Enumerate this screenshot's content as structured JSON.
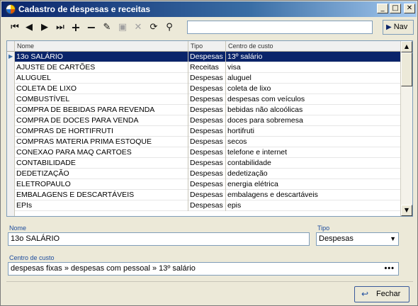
{
  "window": {
    "title": "Cadastro de despesas e receitas"
  },
  "toolbar": {
    "icons": [
      "first-record-icon",
      "prev-record-icon",
      "next-record-icon",
      "last-record-icon",
      "add-icon",
      "delete-icon",
      "edit-icon",
      "save-icon",
      "cancel-icon",
      "refresh-icon",
      "find-icon"
    ],
    "search_value": "",
    "nav_label": "Nav"
  },
  "grid": {
    "columns": [
      "Nome",
      "Tipo",
      "Centro de custo"
    ],
    "rows": [
      [
        "13o SALÁRIO",
        "Despesas",
        "13º salário"
      ],
      [
        "AJUSTE DE CARTÕES",
        "Receitas",
        "visa"
      ],
      [
        "ALUGUEL",
        "Despesas",
        "aluguel"
      ],
      [
        "COLETA DE LIXO",
        "Despesas",
        "coleta de lixo"
      ],
      [
        "COMBUSTÍVEL",
        "Despesas",
        "despesas com veículos"
      ],
      [
        "COMPRA DE BEBIDAS PARA REVENDA",
        "Despesas",
        "bebidas não alcoólicas"
      ],
      [
        "COMPRA DE DOCES PARA VENDA",
        "Despesas",
        "doces para sobremesa"
      ],
      [
        "COMPRAS DE HORTIFRUTI",
        "Despesas",
        "hortifruti"
      ],
      [
        "COMPRAS MATERIA PRIMA ESTOQUE",
        "Despesas",
        "secos"
      ],
      [
        "CONEXAO PARA MAQ CARTOES",
        "Despesas",
        "telefone e internet"
      ],
      [
        "CONTABILIDADE",
        "Despesas",
        "contabilidade"
      ],
      [
        "DEDETIZAÇÃO",
        "Despesas",
        "dedetização"
      ],
      [
        "ELETROPAULO",
        "Despesas",
        "energia elétrica"
      ],
      [
        "EMBALAGENS E DESCARTÁVEIS",
        "Despesas",
        "embalagens e descartáveis"
      ],
      [
        "EPIs",
        "Despesas",
        "epis"
      ]
    ],
    "selected_index": 0
  },
  "form": {
    "nome_label": "Nome",
    "nome_value": "13o SALÁRIO",
    "tipo_label": "Tipo",
    "tipo_value": "Despesas",
    "cc_label": "Centro de custo",
    "cc_value": "despesas fixas » despesas com pessoal » 13º salário",
    "cc_button": "•••"
  },
  "footer": {
    "fechar_label": "Fechar"
  },
  "colors": {
    "accent": "#0a246a",
    "selection": "#0a246a",
    "label": "#1c4c9e"
  }
}
